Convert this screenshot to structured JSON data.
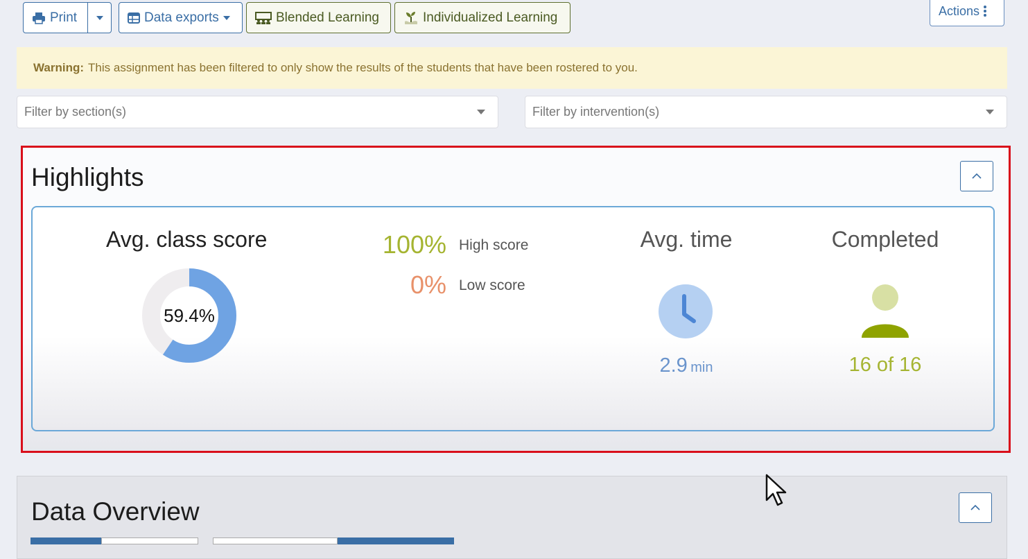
{
  "toolbar": {
    "print_label": "Print",
    "data_exports_label": "Data exports",
    "blended_label": "Blended Learning",
    "individualized_label": "Individualized Learning",
    "actions_label": "Actions"
  },
  "warning": {
    "label": "Warning:",
    "text": "This assignment has been filtered to only show the results of the students that have been rostered to you."
  },
  "filters": {
    "section_placeholder": "Filter by section(s)",
    "intervention_placeholder": "Filter by intervention(s)"
  },
  "highlights": {
    "title": "Highlights",
    "avg_class_score_title": "Avg. class score",
    "avg_class_score_value": "59.4%",
    "avg_class_score_fraction": 0.594,
    "high_score_value": "100%",
    "high_score_label": "High score",
    "low_score_value": "0%",
    "low_score_label": "Low score",
    "avg_time_title": "Avg. time",
    "avg_time_value": "2.9",
    "avg_time_unit": "min",
    "completed_title": "Completed",
    "completed_value": "16 of 16"
  },
  "data_overview": {
    "title": "Data Overview"
  },
  "colors": {
    "primary": "#3a6ea5",
    "green": "#a5b431",
    "orange": "#e8916a",
    "donut": "#6fa3e3",
    "alert_border": "#d90f1b"
  }
}
